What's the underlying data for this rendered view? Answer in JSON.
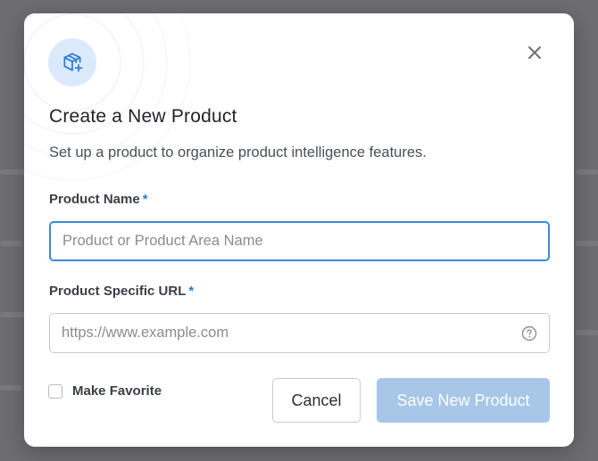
{
  "modal": {
    "title": "Create a New Product",
    "subtitle": "Set up a product to organize product intelligence features.",
    "header_icon": "box-plus-icon",
    "close_icon": "close-icon"
  },
  "form": {
    "product_name": {
      "label": "Product Name",
      "required_marker": "*",
      "value": "",
      "placeholder": "Product or Product Area Name"
    },
    "product_url": {
      "label": "Product Specific URL",
      "required_marker": "*",
      "value": "",
      "placeholder": "https://www.example.com",
      "help_icon": "question-circle-icon"
    },
    "favorite": {
      "label": "Make Favorite",
      "checked": false
    }
  },
  "actions": {
    "cancel_label": "Cancel",
    "save_label": "Save New Product",
    "save_enabled": false
  },
  "colors": {
    "accent": "#3a8bd8",
    "required": "#2f7bd1",
    "save_disabled_bg": "#a7c6e8",
    "icon_bg": "#dbeafb",
    "backdrop": "#6d6d6f"
  }
}
